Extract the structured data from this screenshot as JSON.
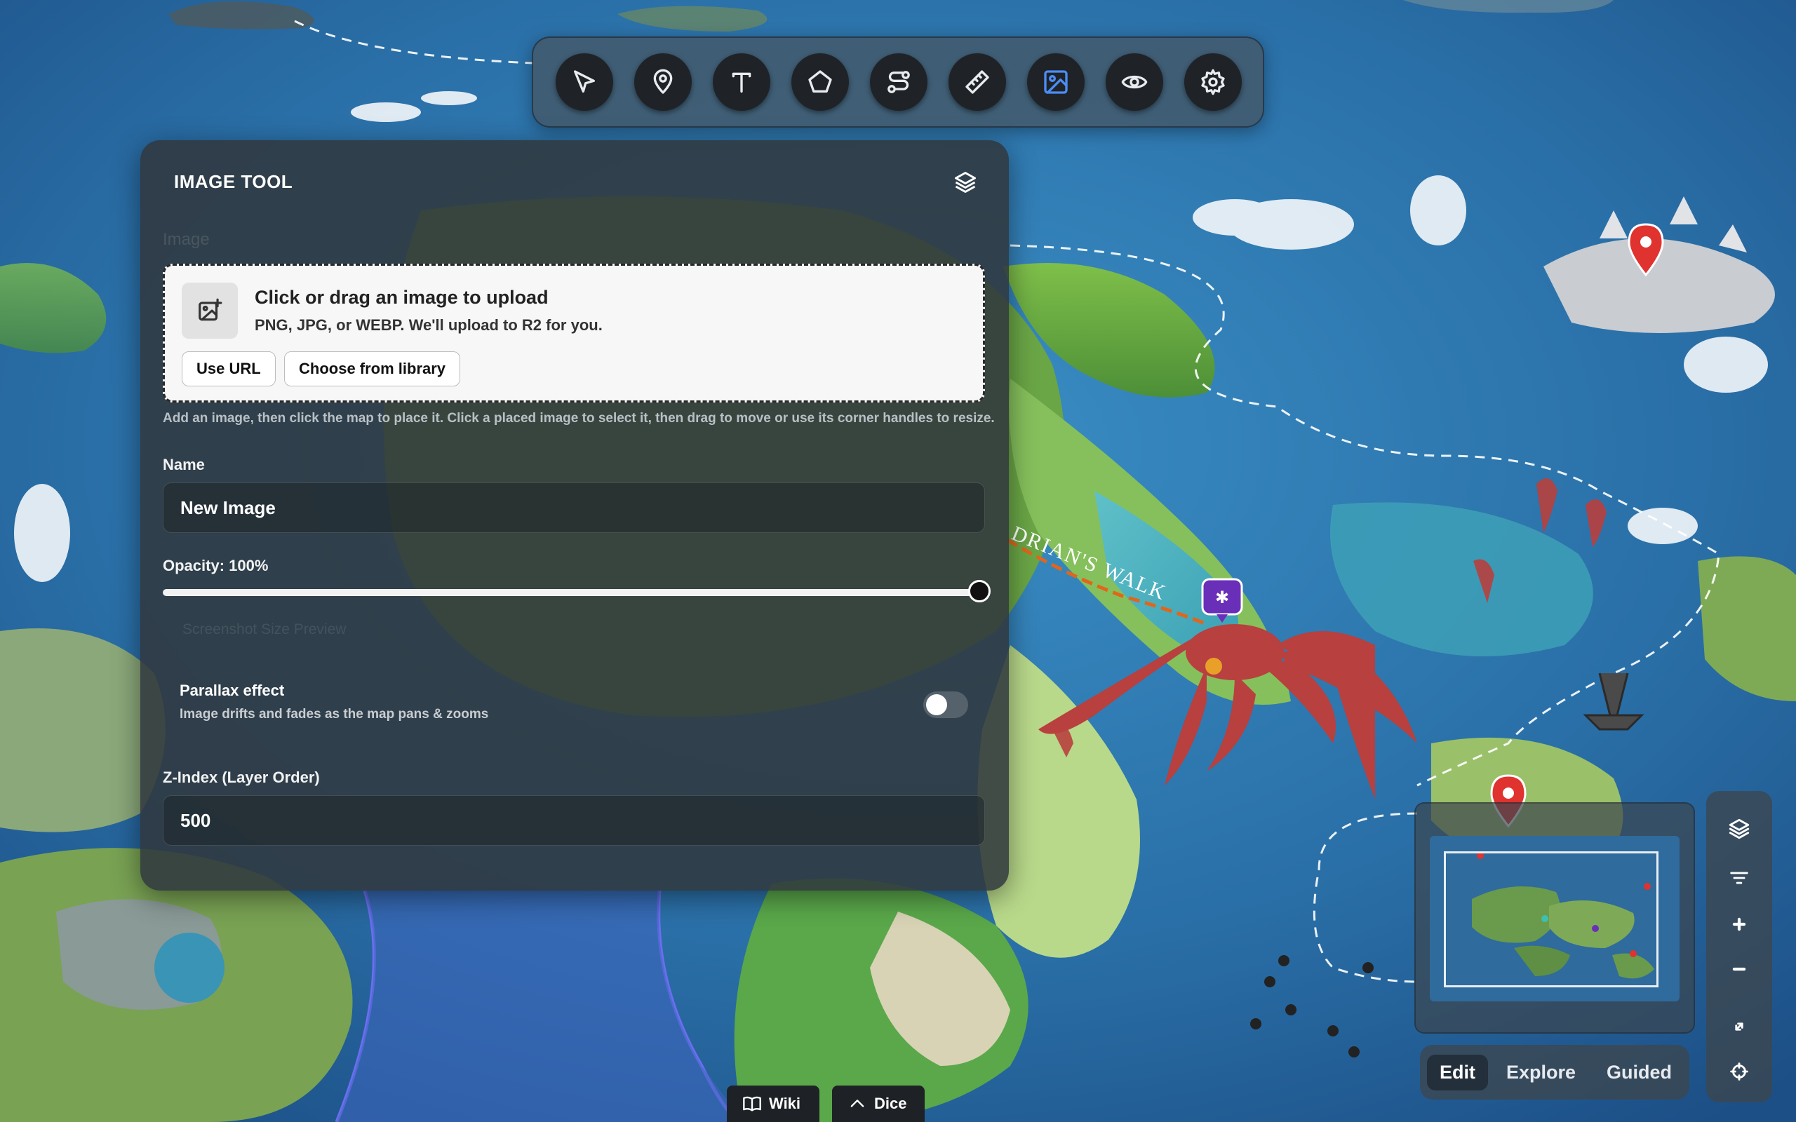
{
  "toolbar": {
    "tools": [
      {
        "name": "select",
        "icon": "cursor-icon"
      },
      {
        "name": "marker",
        "icon": "map-pin-icon"
      },
      {
        "name": "text",
        "icon": "text-icon"
      },
      {
        "name": "polygon",
        "icon": "pentagon-icon"
      },
      {
        "name": "path",
        "icon": "route-icon"
      },
      {
        "name": "measure",
        "icon": "ruler-icon"
      },
      {
        "name": "image",
        "icon": "image-icon",
        "active": true
      },
      {
        "name": "visibility",
        "icon": "eye-icon"
      },
      {
        "name": "settings",
        "icon": "gear-icon"
      }
    ],
    "active_color": "#4c8df6"
  },
  "panel": {
    "title": "IMAGE TOOL",
    "ghost_label": "Image",
    "upload": {
      "title": "Click or drag an image to upload",
      "subtitle": "PNG, JPG, or WEBP. We'll upload to R2 for you.",
      "use_url_label": "Use URL",
      "library_label": "Choose from library"
    },
    "hint": "Add an image, then click the map to place it. Click a placed image to select it, then drag to move or use its corner handles to resize.",
    "name_label": "Name",
    "name_value": "New Image",
    "opacity_label": "Opacity: 100%",
    "opacity_value": 1.0,
    "ghost_label_2": "Screenshot Size Preview",
    "parallax": {
      "title": "Parallax effect",
      "subtitle": "Image drifts and fades as the map pans & zooms",
      "enabled": false
    },
    "zindex_label": "Z-Index (Layer Order)",
    "zindex_value": "500"
  },
  "map": {
    "route_label": "DRIAN'S WALK",
    "route_color": "#e0661c",
    "pin_color": "#e0322f",
    "creature_marker_color": "#6a2fb8"
  },
  "bottom": {
    "wiki_label": "Wiki",
    "dice_label": "Dice"
  },
  "modes": {
    "items": [
      "Edit",
      "Explore",
      "Guided"
    ],
    "active": "Edit"
  },
  "rail": {
    "buttons": [
      "layers-icon",
      "filter-icon",
      "zoom-in-icon",
      "zoom-out-icon",
      "expand-icon",
      "locate-icon"
    ]
  }
}
